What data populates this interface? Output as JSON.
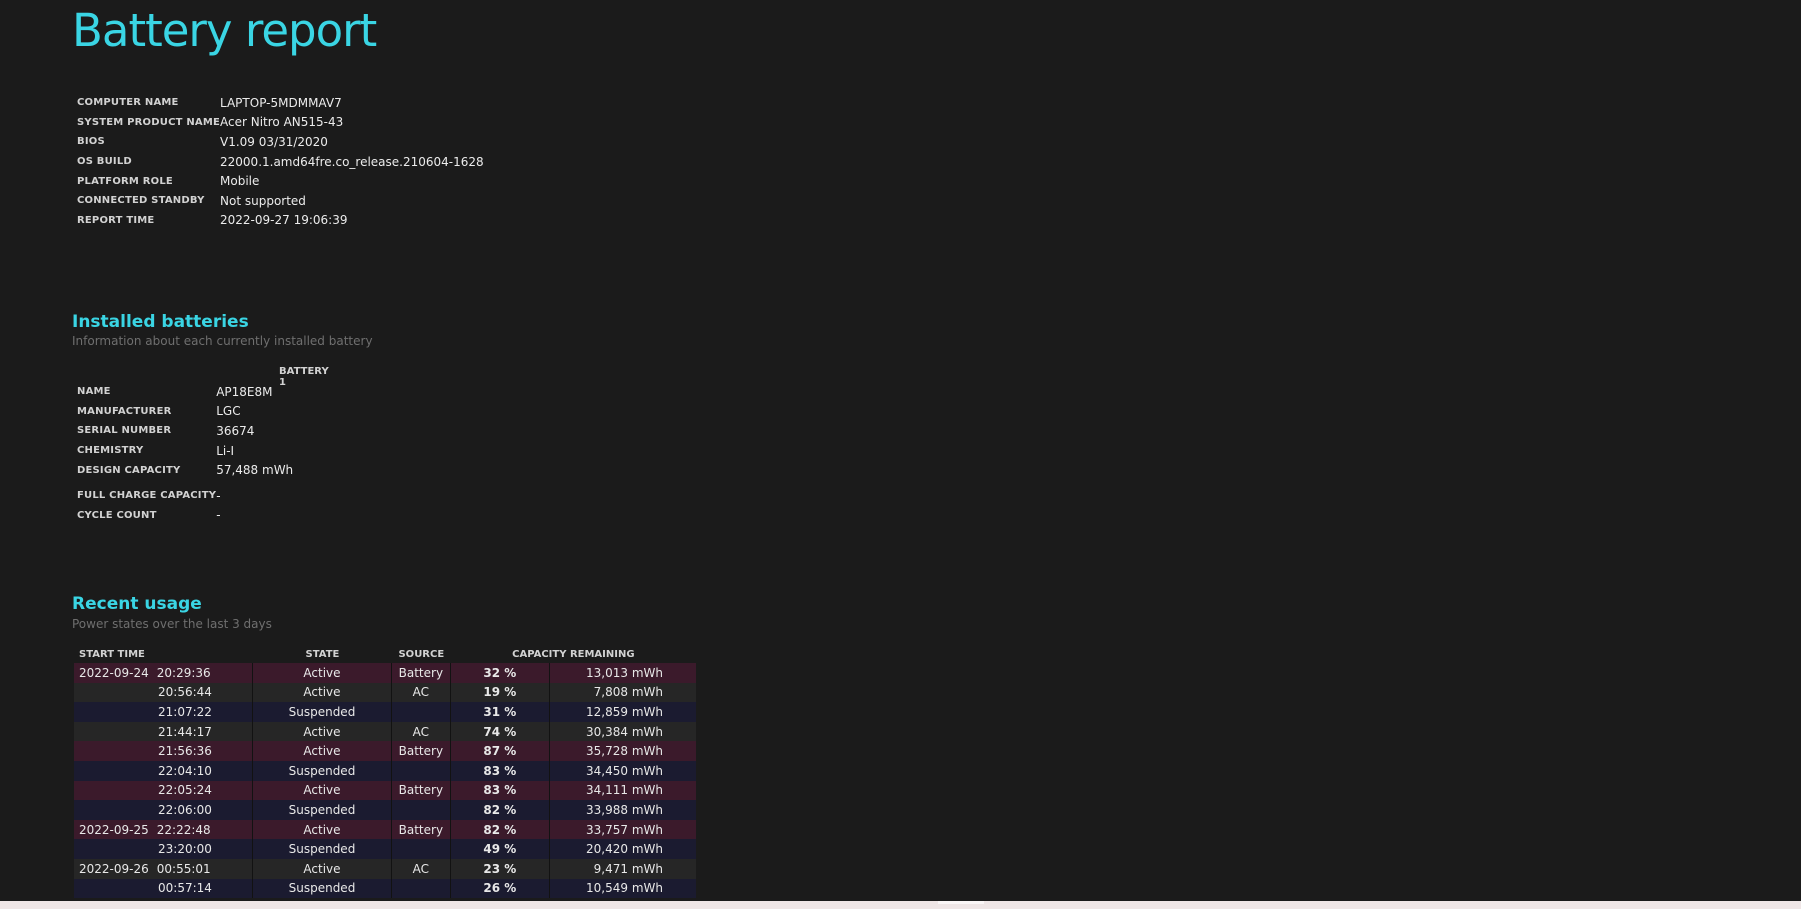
{
  "report": {
    "title": "Battery report"
  },
  "system_info": [
    {
      "label": "COMPUTER NAME",
      "value": "LAPTOP-5MDMMAV7"
    },
    {
      "label": "SYSTEM PRODUCT NAME",
      "value": "Acer Nitro AN515-43"
    },
    {
      "label": "BIOS",
      "value": "V1.09 03/31/2020"
    },
    {
      "label": "OS BUILD",
      "value": "22000.1.amd64fre.co_release.210604-1628"
    },
    {
      "label": "PLATFORM ROLE",
      "value": "Mobile"
    },
    {
      "label": "CONNECTED STANDBY",
      "value": "Not supported"
    },
    {
      "label": "REPORT TIME",
      "value": "2022-09-27  19:06:39"
    }
  ],
  "installed_batteries": {
    "title": "Installed batteries",
    "subtitle": "Information about each currently installed battery",
    "column_header": "BATTERY 1",
    "rows": [
      {
        "label": "NAME",
        "value": "AP18E8M"
      },
      {
        "label": "MANUFACTURER",
        "value": "LGC"
      },
      {
        "label": "SERIAL NUMBER",
        "value": "36674"
      },
      {
        "label": "CHEMISTRY",
        "value": "Li-I"
      },
      {
        "label": "DESIGN CAPACITY",
        "value": "57,488 mWh"
      },
      {
        "label": "FULL CHARGE CAPACITY",
        "value": "-"
      },
      {
        "label": "CYCLE COUNT",
        "value": "-"
      }
    ]
  },
  "recent_usage": {
    "title": "Recent usage",
    "subtitle": "Power states over the last 3 days",
    "headers": {
      "start_time": "START TIME",
      "state": "STATE",
      "source": "SOURCE",
      "capacity_remaining": "CAPACITY REMAINING"
    },
    "rows": [
      {
        "date": "2022-09-24",
        "time": "20:29:36",
        "state": "Active",
        "source": "Battery",
        "percent": "32 %",
        "mwh": "13,013 mWh",
        "kind": "battery"
      },
      {
        "date": "",
        "time": "20:56:44",
        "state": "Active",
        "source": "AC",
        "percent": "19 %",
        "mwh": "7,808 mWh",
        "kind": "ac"
      },
      {
        "date": "",
        "time": "21:07:22",
        "state": "Suspended",
        "source": "",
        "percent": "31 %",
        "mwh": "12,859 mWh",
        "kind": "suspended"
      },
      {
        "date": "",
        "time": "21:44:17",
        "state": "Active",
        "source": "AC",
        "percent": "74 %",
        "mwh": "30,384 mWh",
        "kind": "ac"
      },
      {
        "date": "",
        "time": "21:56:36",
        "state": "Active",
        "source": "Battery",
        "percent": "87 %",
        "mwh": "35,728 mWh",
        "kind": "battery"
      },
      {
        "date": "",
        "time": "22:04:10",
        "state": "Suspended",
        "source": "",
        "percent": "83 %",
        "mwh": "34,450 mWh",
        "kind": "suspended"
      },
      {
        "date": "",
        "time": "22:05:24",
        "state": "Active",
        "source": "Battery",
        "percent": "83 %",
        "mwh": "34,111 mWh",
        "kind": "battery"
      },
      {
        "date": "",
        "time": "22:06:00",
        "state": "Suspended",
        "source": "",
        "percent": "82 %",
        "mwh": "33,988 mWh",
        "kind": "suspended"
      },
      {
        "date": "2022-09-25",
        "time": "22:22:48",
        "state": "Active",
        "source": "Battery",
        "percent": "82 %",
        "mwh": "33,757 mWh",
        "kind": "battery"
      },
      {
        "date": "",
        "time": "23:20:00",
        "state": "Suspended",
        "source": "",
        "percent": "49 %",
        "mwh": "20,420 mWh",
        "kind": "suspended"
      },
      {
        "date": "2022-09-26",
        "time": "00:55:01",
        "state": "Active",
        "source": "AC",
        "percent": "23 %",
        "mwh": "9,471 mWh",
        "kind": "ac"
      },
      {
        "date": "",
        "time": "00:57:14",
        "state": "Suspended",
        "source": "",
        "percent": "26 %",
        "mwh": "10,549 mWh",
        "kind": "suspended"
      }
    ]
  },
  "colors": {
    "background": "#1b1b1b",
    "accent": "#3ad5e4",
    "row_battery": "#3b1a2b",
    "row_ac": "#262626",
    "row_suspended": "#1b1b30"
  }
}
